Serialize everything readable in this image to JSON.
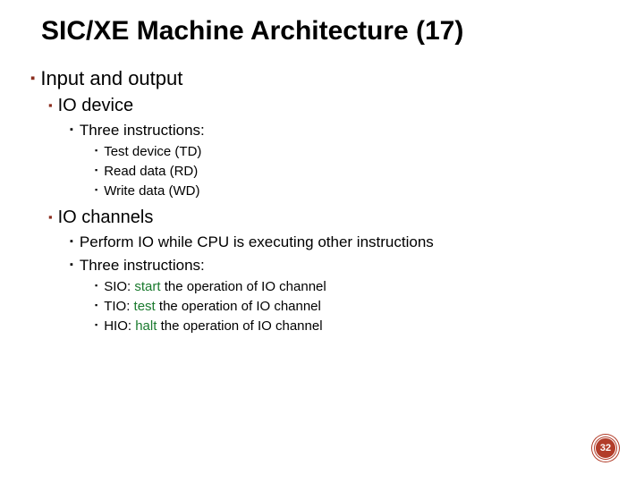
{
  "title": "SIC/XE Machine Architecture (17)",
  "l1": {
    "text": "Input and output"
  },
  "l2a": {
    "text": "IO device"
  },
  "l3a": {
    "text": "Three instructions:"
  },
  "l4a": {
    "text": "Test device (TD)"
  },
  "l4b": {
    "text": "Read data (RD)"
  },
  "l4c": {
    "text": "Write data (WD)"
  },
  "l2b": {
    "text": "IO channels"
  },
  "l3b": {
    "text": "Perform IO while CPU is executing other instructions"
  },
  "l3c": {
    "text": "Three instructions:"
  },
  "l4d": {
    "pre": "SIO: ",
    "kw": "start",
    "post": " the operation of IO channel"
  },
  "l4e": {
    "pre": "TIO: ",
    "kw": "test",
    "post": " the operation of IO channel"
  },
  "l4f": {
    "pre": "HIO: ",
    "kw": "halt",
    "post": " the operation of IO channel"
  },
  "pageNumber": "32"
}
